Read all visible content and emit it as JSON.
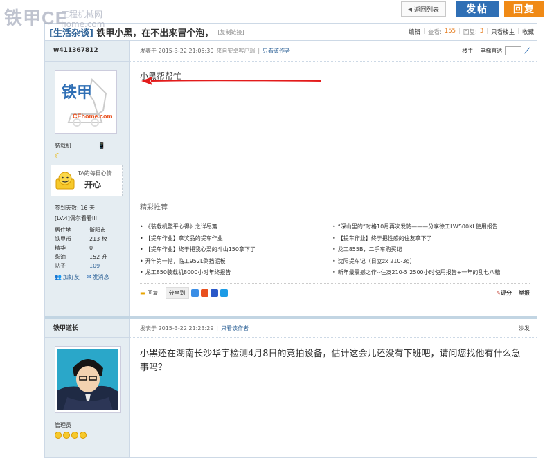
{
  "watermark": {
    "brand": "铁甲",
    "brand_latin": "CE",
    "cn": "工程机械网",
    "url": "home.com"
  },
  "top": {
    "back": "返回列表",
    "post": "发帖",
    "reply": "回复"
  },
  "thread": {
    "category": "[生活杂谈]",
    "title": "铁甲小黑，在不出来冒个泡，",
    "copy_link": "[复制链接]",
    "edit": "编辑",
    "views_label": "查看:",
    "views": "155",
    "replies_label": "回复:",
    "replies": "3",
    "only_op": "只看楼主",
    "favorite": "收藏"
  },
  "post1": {
    "username": "w411367812",
    "avatar_text": "铁甲",
    "avatar_sub": "CEhome.com",
    "role": "装载机",
    "mood_label": "TA的每日心情",
    "mood": "开心",
    "stats": [
      {
        "k": "签到天数:",
        "v": "16 天"
      },
      {
        "k": "[LV.4]偶尔看看III",
        "v": ""
      }
    ],
    "kv": [
      {
        "k": "居住地",
        "v": "衡阳市"
      },
      {
        "k": "铁甲币",
        "v": "213 枚"
      },
      {
        "k": "精华",
        "v": "0"
      },
      {
        "k": "柴油",
        "v": "152 升"
      },
      {
        "k": "帖子",
        "v": "109"
      }
    ],
    "add_friend": "加好友",
    "send_msg": "发消息",
    "time": "发表于 2015-3-22 21:05:30",
    "client": "来自安卓客户端",
    "only_author": "只看该作者",
    "floor": "楼主",
    "jump": "电梯直达",
    "content": "小黑帮帮忙",
    "rec_title": "精彩推荐",
    "recs_left": [
      "《装载机整平心得》之详尽篇",
      "【提车作业】拿奖品的提车作业",
      "【提车作业】终于把我心爱的斗山150拿下了",
      "开年第一帖，临工952L倒挡泥板",
      "龙工850装载机8000小时年终报告"
    ],
    "recs_right": [
      "“深山里的”时格10月再次发帖———分享徐工LW500KL使用报告",
      "【提车作业】终于把性感的住友拿下了",
      "龙工855B，二手车购买记",
      "沈阳提车记（日立zx 210-3g）",
      "新年最震撼之作--住友210-5 2500小时使用报告+一年的乱七八糟"
    ],
    "reply": "回复",
    "share": "分享到",
    "rate": "评分",
    "report": "举报"
  },
  "post2": {
    "username": "铁甲道长",
    "role": "管理员",
    "time": "发表于 2015-3-22 21:23:29",
    "only_author": "只看该作者",
    "floor": "沙发",
    "content": "小黑还在湖南长沙华宇检测4月8日的竞拍设备，估计这会儿还没有下班吧，请问您找他有什么急事吗？"
  },
  "colors": {
    "accent": "#2f6fb5",
    "orange": "#f08a16",
    "sidebar": "#e5edf2",
    "border": "#cdd9e6"
  }
}
